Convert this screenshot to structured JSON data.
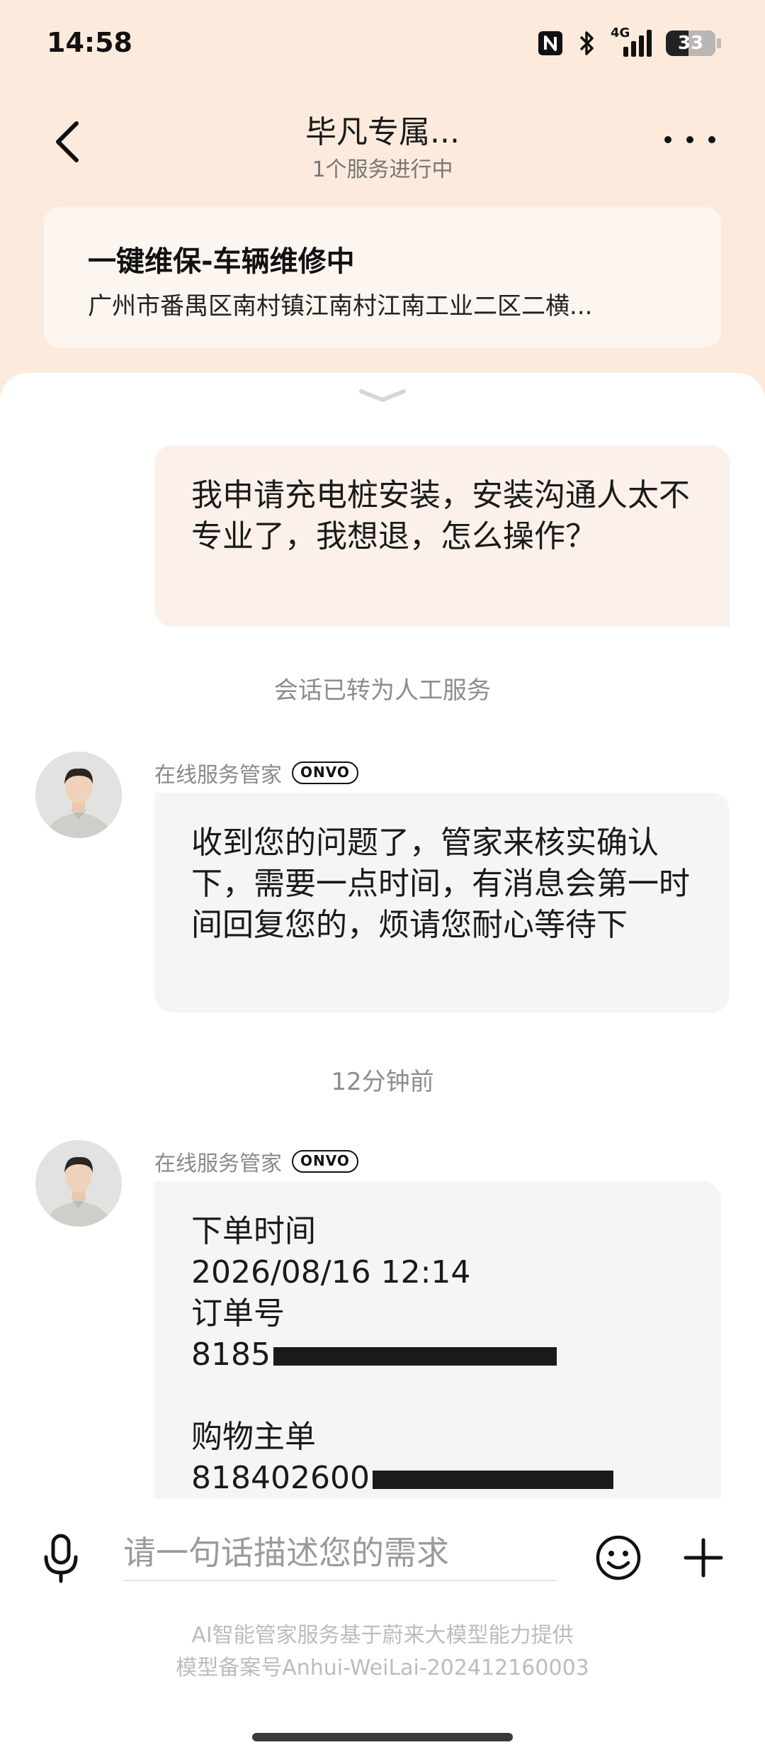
{
  "status_bar": {
    "time": "14:58",
    "network": "4G",
    "battery": "33",
    "icons": [
      "nfc-icon",
      "bluetooth-icon",
      "signal-icon",
      "battery-icon"
    ]
  },
  "header": {
    "title": "毕凡专属...",
    "subtitle": "1个服务进行中"
  },
  "service_card": {
    "title": "一键维保-车辆维修中",
    "address": "广州市番禺区南村镇江南村江南工业二区二横..."
  },
  "messages": {
    "user_message": "我申请充电桩安装，安装沟通人太不专业了，我想退，怎么操作？",
    "system_note": "会话已转为人工服务",
    "agent_name": "在线服务管家",
    "agent_badge": "ONVO",
    "agent_reply": "收到您的问题了，管家来核实确认下，需要一点时间，有消息会第一时间回复您的，烦请您耐心等待下",
    "time_note": "12分钟前",
    "order": {
      "time_label": "下单时间",
      "time_value": "2026/08/16 12:14",
      "order_no_label": "订单号",
      "order_no_visible": "8185",
      "main_order_label": "购物主单",
      "main_order_visible": "818402600"
    }
  },
  "input": {
    "placeholder": "请一句话描述您的需求"
  },
  "footer": {
    "line1": "AI智能管家服务基于蔚来大模型能力提供",
    "line2": "模型备案号Anhui-WeiLai-202412160003"
  },
  "colors": {
    "header_bg": "#fcebdc",
    "user_bubble": "#fbf1ea",
    "agent_bubble": "#f5f5f5"
  }
}
